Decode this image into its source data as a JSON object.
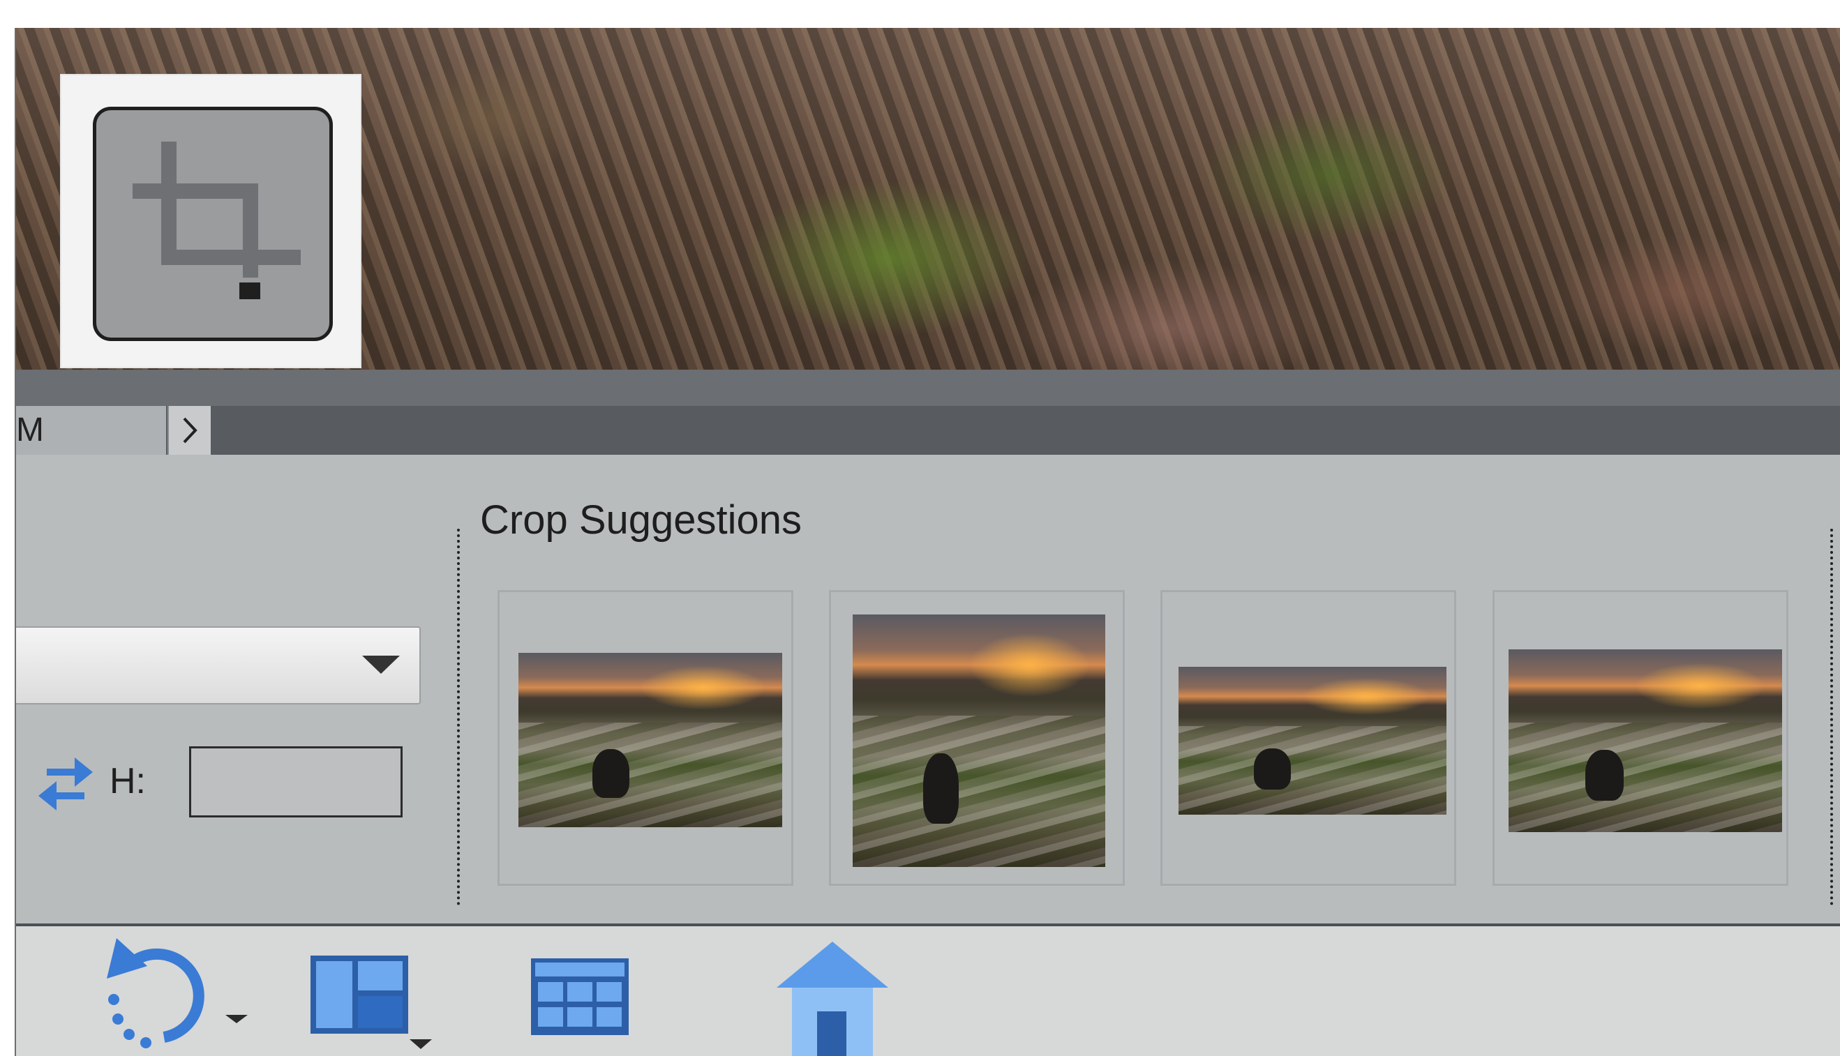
{
  "tool": {
    "icon": "crop-icon"
  },
  "tabs": {
    "partial_label": "M",
    "next_icon": "chevron-right-icon"
  },
  "options": {
    "dropdown_value": "",
    "height_label": "H:",
    "height_value": "",
    "swap_icon": "swap-arrows-icon"
  },
  "crop_suggestions": {
    "title": "Crop Suggestions",
    "items": [
      {
        "label": "suggestion-1"
      },
      {
        "label": "suggestion-2"
      },
      {
        "label": "suggestion-3"
      },
      {
        "label": "suggestion-4"
      }
    ]
  },
  "toolbar": {
    "icons": [
      "undo-icon",
      "layout-icon",
      "grid-view-icon",
      "home-icon"
    ]
  },
  "colors": {
    "accent_blue": "#3a7bd5",
    "panel_gray": "#b9bcbd"
  }
}
